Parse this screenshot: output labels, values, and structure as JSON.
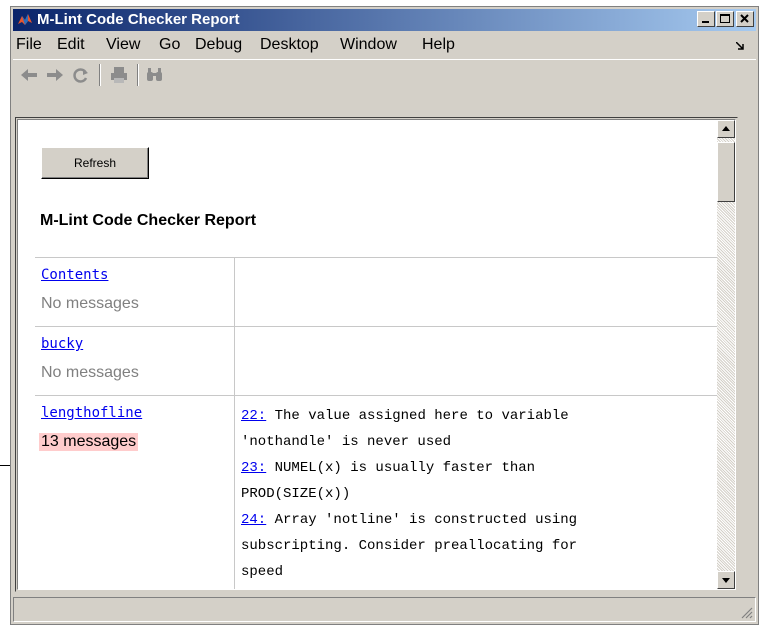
{
  "window": {
    "title": "M-Lint Code Checker Report"
  },
  "menu": {
    "items": [
      "File",
      "Edit",
      "View",
      "Go",
      "Debug",
      "Desktop",
      "Window",
      "Help"
    ]
  },
  "toolbar": {
    "icons": [
      "back-icon",
      "forward-icon",
      "refresh-icon",
      "print-icon",
      "find-icon"
    ]
  },
  "report": {
    "refresh_label": "Refresh",
    "heading": "M-Lint Code Checker Report",
    "files": [
      {
        "name": "Contents",
        "count": "No messages"
      },
      {
        "name": "bucky",
        "count": "No messages"
      },
      {
        "name": "lengthofline",
        "count": "13 messages"
      }
    ],
    "messages": [
      {
        "line": "22:",
        "text": " The value assigned here to variable"
      },
      {
        "line": "",
        "text": "'nothandle' is never used"
      },
      {
        "line": "23:",
        "text": " NUMEL(x) is usually faster than"
      },
      {
        "line": "",
        "text": "PROD(SIZE(x))"
      },
      {
        "line": "24:",
        "text": " Array 'notline' is constructed using"
      },
      {
        "line": "",
        "text": "subscripting. Consider preallocating for"
      },
      {
        "line": "",
        "text": "speed"
      }
    ]
  },
  "colors": {
    "title_bar_start": "#0a246a",
    "title_bar_end": "#a6caf0",
    "link": "#0000ee",
    "warning_highlight": "#ffcccc"
  }
}
